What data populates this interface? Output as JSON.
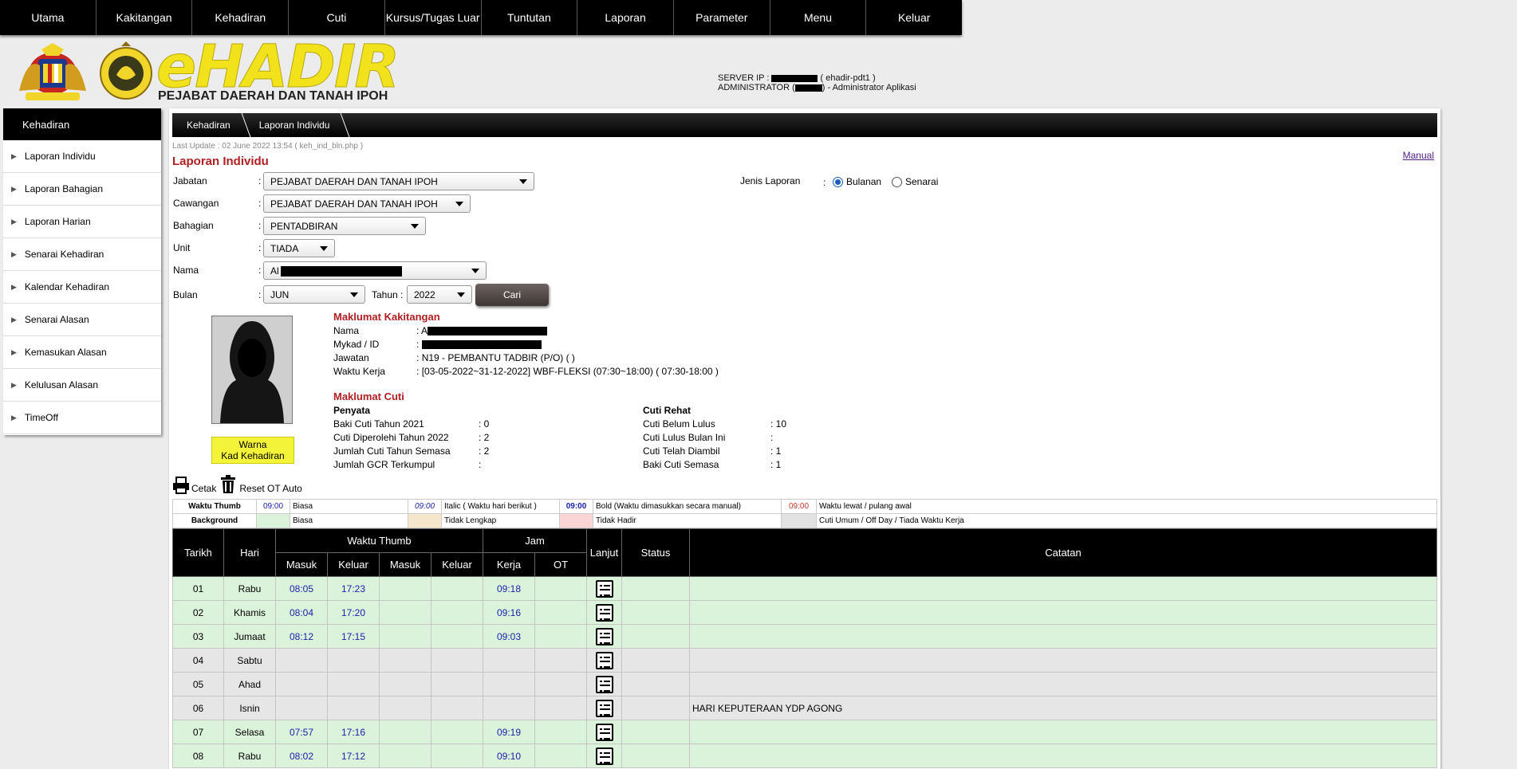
{
  "topnav": [
    "Utama",
    "Kakitangan",
    "Kehadiran",
    "Cuti",
    "Kursus/Tugas Luar",
    "Tuntutan",
    "Laporan",
    "Parameter",
    "Menu",
    "Keluar"
  ],
  "header": {
    "logo": "eHADIR",
    "subtitle": "PEJABAT DAERAH DAN TANAH IPOH",
    "server_label": "SERVER IP :",
    "server_host": "( ehadir-pdt1 )",
    "admin_label": "ADMINISTRATOR (",
    "admin_role": ") - Administrator Aplikasi"
  },
  "sidebar": {
    "title": "Kehadiran",
    "items": [
      "Laporan Individu",
      "Laporan Bahagian",
      "Laporan Harian",
      "Senarai Kehadiran",
      "Kalendar Kehadiran",
      "Senarai Alasan",
      "Kemasukan Alasan",
      "Kelulusan Alasan",
      "TimeOff"
    ]
  },
  "breadcrumb": [
    "Kehadiran",
    "Laporan Individu"
  ],
  "last_update": "Last Update : 02 June 2022 13:54 ( keh_ind_bln.php )",
  "manual": "Manual",
  "page_title": "Laporan Individu",
  "form": {
    "jabatan_label": "Jabatan",
    "jabatan_value": "PEJABAT DAERAH DAN TANAH IPOH",
    "cawangan_label": "Cawangan",
    "cawangan_value": "PEJABAT DAERAH DAN TANAH IPOH",
    "bahagian_label": "Bahagian",
    "bahagian_value": "PENTADBIRAN",
    "unit_label": "Unit",
    "unit_value": "TIADA",
    "nama_label": "Nama",
    "nama_value": "Al",
    "bulan_label": "Bulan",
    "bulan_value": "JUN",
    "tahun_label": "Tahun :",
    "tahun_value": "2022",
    "cari": "Cari",
    "jenis_label": "Jenis Laporan",
    "radio_bulanan": "Bulanan",
    "radio_senarai": "Senarai",
    "colon": ":"
  },
  "warna": [
    "Warna",
    "Kad Kehadiran"
  ],
  "maklumat_kakitangan": {
    "title": "Maklumat Kakitangan",
    "rows": [
      {
        "label": "Nama",
        "value": "A"
      },
      {
        "label": "Mykad / ID",
        "value": ""
      },
      {
        "label": "Jawatan",
        "value": "N19 - PEMBANTU TADBIR (P/O) ( )"
      },
      {
        "label": "Waktu Kerja",
        "value": "[03-05-2022~31-12-2022] WBF-FLEKSI (07:30~18:00) ( 07:30-18:00 )"
      }
    ]
  },
  "maklumat_cuti": {
    "title": "Maklumat Cuti",
    "penyata_title": "Penyata",
    "penyata": [
      {
        "label": "Baki Cuti Tahun 2021",
        "value": ": 0"
      },
      {
        "label": "Cuti Diperolehi Tahun 2022",
        "value": ": 2"
      },
      {
        "label": "Jumlah Cuti Tahun Semasa",
        "value": ": 2"
      },
      {
        "label": "Jumlah GCR Terkumpul",
        "value": ":"
      }
    ],
    "rehat_title": "Cuti Rehat",
    "rehat": [
      {
        "label": "Cuti Belum Lulus",
        "value": ": 10"
      },
      {
        "label": "Cuti Lulus Bulan Ini",
        "value": ":"
      },
      {
        "label": "Cuti Telah Diambil",
        "value": ": 1"
      },
      {
        "label": "Baki Cuti Semasa",
        "value": ": 1"
      }
    ]
  },
  "tools": {
    "cetak": "Cetak",
    "reset": "Reset OT Auto"
  },
  "legend": {
    "waktu_thumb": "Waktu Thumb",
    "background": "Background",
    "sample": "09:00",
    "biasa": "Biasa",
    "italic": "Italic ( Waktu hari berikut )",
    "bold": "Bold (Waktu dimasukkan secara manual)",
    "lewat": "Waktu lewat / pulang awal",
    "tidak_lengkap": "Tidak Lengkap",
    "tidak_hadir": "Tidak Hadir",
    "cuti_umum": "Cuti Umum / Off Day / Tiada Waktu Kerja",
    "colors": {
      "green": "#dbf3db",
      "beige": "#f5e6cc",
      "pink": "#f9d5d5",
      "grey": "#e2e2e2",
      "blue": "#1a23a8",
      "red": "#c0392b"
    }
  },
  "table": {
    "headers": {
      "tarikh": "Tarikh",
      "hari": "Hari",
      "waktu_thumb": "Waktu Thumb",
      "jam": "Jam",
      "lanjut": "Lanjut",
      "status": "Status",
      "catatan": "Catatan",
      "masuk": "Masuk",
      "keluar": "Keluar",
      "kerja": "Kerja",
      "ot": "OT"
    },
    "rows": [
      {
        "tarikh": "01",
        "hari": "Rabu",
        "masuk": "08:05",
        "keluar": "17:23",
        "masuk2": "",
        "keluar2": "",
        "kerja": "09:18",
        "ot": "",
        "status": "",
        "catatan": "",
        "bg": "green"
      },
      {
        "tarikh": "02",
        "hari": "Khamis",
        "masuk": "08:04",
        "keluar": "17:20",
        "masuk2": "",
        "keluar2": "",
        "kerja": "09:16",
        "ot": "",
        "status": "",
        "catatan": "",
        "bg": "green"
      },
      {
        "tarikh": "03",
        "hari": "Jumaat",
        "masuk": "08:12",
        "keluar": "17:15",
        "masuk2": "",
        "keluar2": "",
        "kerja": "09:03",
        "ot": "",
        "status": "",
        "catatan": "",
        "bg": "green"
      },
      {
        "tarikh": "04",
        "hari": "Sabtu",
        "masuk": "",
        "keluar": "",
        "masuk2": "",
        "keluar2": "",
        "kerja": "",
        "ot": "",
        "status": "",
        "catatan": "",
        "bg": "grey"
      },
      {
        "tarikh": "05",
        "hari": "Ahad",
        "masuk": "",
        "keluar": "",
        "masuk2": "",
        "keluar2": "",
        "kerja": "",
        "ot": "",
        "status": "",
        "catatan": "",
        "bg": "grey"
      },
      {
        "tarikh": "06",
        "hari": "Isnin",
        "masuk": "",
        "keluar": "",
        "masuk2": "",
        "keluar2": "",
        "kerja": "",
        "ot": "",
        "status": "",
        "catatan": "HARI KEPUTERAAN YDP AGONG",
        "bg": "grey"
      },
      {
        "tarikh": "07",
        "hari": "Selasa",
        "masuk": "07:57",
        "keluar": "17:16",
        "masuk2": "",
        "keluar2": "",
        "kerja": "09:19",
        "ot": "",
        "status": "",
        "catatan": "",
        "bg": "green"
      },
      {
        "tarikh": "08",
        "hari": "Rabu",
        "masuk": "08:02",
        "keluar": "17:12",
        "masuk2": "",
        "keluar2": "",
        "kerja": "09:10",
        "ot": "",
        "status": "",
        "catatan": "",
        "bg": "green"
      }
    ]
  }
}
